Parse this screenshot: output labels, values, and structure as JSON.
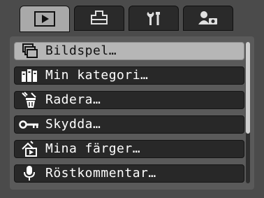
{
  "tabs": [
    {
      "icon": "play-icon",
      "active": true
    },
    {
      "icon": "print-icon",
      "active": false
    },
    {
      "icon": "tools-icon",
      "active": false
    },
    {
      "icon": "user-camera-icon",
      "active": false
    }
  ],
  "menu": {
    "items": [
      {
        "label": "Bildspel…",
        "icon": "slideshow-icon",
        "selected": true
      },
      {
        "label": "Min kategori…",
        "icon": "category-icon",
        "selected": false
      },
      {
        "label": "Radera…",
        "icon": "erase-icon",
        "selected": false
      },
      {
        "label": "Skydda…",
        "icon": "key-icon",
        "selected": false
      },
      {
        "label": "Mina färger…",
        "icon": "my-colors-icon",
        "selected": false
      },
      {
        "label": "Röstkommentar…",
        "icon": "microphone-icon",
        "selected": false
      }
    ]
  },
  "scroll": {
    "visible_fraction": 0.65,
    "position_fraction": 0.0
  }
}
